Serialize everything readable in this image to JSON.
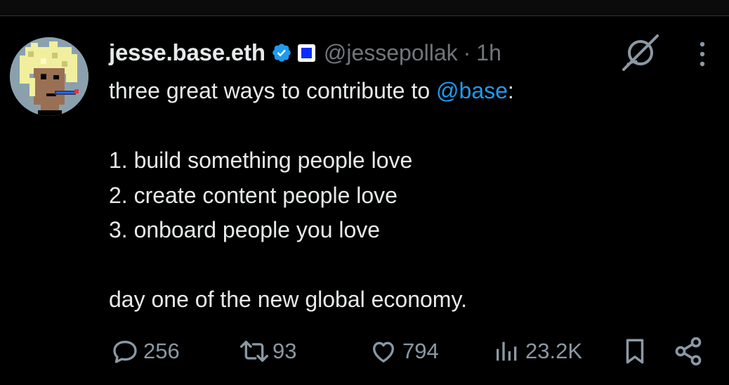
{
  "tweet": {
    "display_name": "jesse.base.eth",
    "handle": "@jessepollak",
    "separator": "·",
    "time": "1h",
    "text": {
      "intro_prefix": "three great ways to contribute to ",
      "mention": "@base",
      "intro_suffix": ":",
      "items": [
        "1. build something people love",
        "2. create content people love",
        "3. onboard people you love"
      ],
      "closing": "day one of the new global economy."
    }
  },
  "actions": {
    "replies": "256",
    "reposts": "93",
    "likes": "794",
    "views": "23.2K"
  },
  "colors": {
    "background": "#000000",
    "text": "#e7e9ea",
    "muted": "#71767b",
    "accent": "#1d9bf0",
    "affiliate_badge": "#0a2cff"
  },
  "icons": [
    "verified-badge-icon",
    "affiliate-badge-icon",
    "grok-icon",
    "more-icon",
    "reply-icon",
    "repost-icon",
    "like-icon",
    "views-icon",
    "bookmark-icon",
    "share-icon"
  ]
}
